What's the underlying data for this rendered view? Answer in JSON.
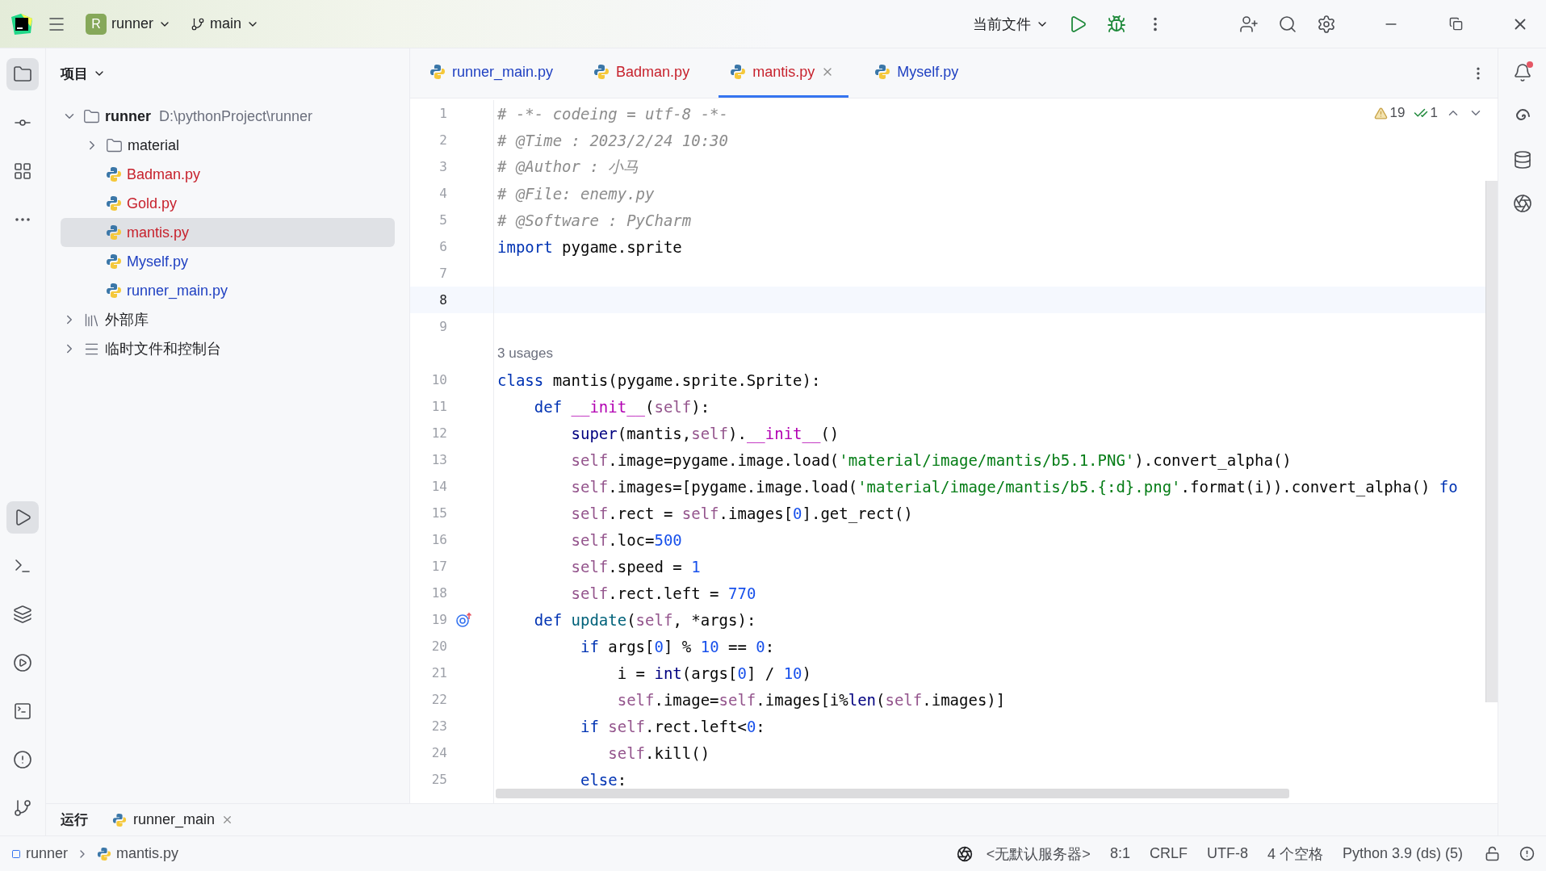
{
  "toolbar": {
    "project_badge": "R",
    "project": "runner",
    "branch": "main",
    "run_config": "当前文件"
  },
  "left_tools_top": [
    {
      "kind": "project",
      "selected": true
    },
    {
      "kind": "commit",
      "selected": false
    },
    {
      "kind": "structure",
      "selected": false
    },
    {
      "kind": "more",
      "selected": false
    }
  ],
  "left_tools_bottom": [
    {
      "kind": "run",
      "selected": true
    },
    {
      "kind": "console",
      "selected": false
    },
    {
      "kind": "layers",
      "selected": false
    },
    {
      "kind": "services",
      "selected": false
    },
    {
      "kind": "terminal",
      "selected": false
    },
    {
      "kind": "problems",
      "selected": false
    },
    {
      "kind": "git",
      "selected": false
    }
  ],
  "right_tools": [
    {
      "kind": "notifications",
      "unread": true
    },
    {
      "kind": "ai",
      "unread": false
    },
    {
      "kind": "database",
      "unread": false
    },
    {
      "kind": "assistant",
      "unread": false
    }
  ],
  "project_panel": {
    "title": "项目",
    "tree": [
      {
        "label": "runner",
        "path": "D:\\pythonProject\\runner",
        "kind": "folder",
        "expanded": true,
        "selected": false,
        "children": [
          {
            "label": "material",
            "kind": "folder",
            "expanded": false,
            "selected": false
          },
          {
            "label": "Badman.py",
            "kind": "python",
            "color": "#c7222d",
            "selected": false
          },
          {
            "label": "Gold.py",
            "kind": "python",
            "color": "#c7222d",
            "selected": false
          },
          {
            "label": "mantis.py",
            "kind": "python",
            "color": "#c7222d",
            "selected": true
          },
          {
            "label": "Myself.py",
            "kind": "python",
            "color": "#2041c2",
            "selected": false
          },
          {
            "label": "runner_main.py",
            "kind": "python",
            "color": "#2041c2",
            "selected": false
          }
        ]
      },
      {
        "label": "外部库",
        "kind": "library",
        "expanded": false,
        "selected": false
      },
      {
        "label": "临时文件和控制台",
        "kind": "scratch",
        "expanded": false,
        "selected": false
      }
    ]
  },
  "tabs": [
    {
      "label": "runner_main.py",
      "color": "#2041c2",
      "selected": false
    },
    {
      "label": "Badman.py",
      "color": "#c7222d",
      "selected": false
    },
    {
      "label": "mantis.py",
      "color": "#c7222d",
      "selected": true
    },
    {
      "label": "Myself.py",
      "color": "#2041c2",
      "selected": false
    }
  ],
  "inspections": {
    "warnings": "19",
    "ok": "1"
  },
  "lines": [
    {
      "no": "1",
      "tokens": [
        {
          "kind": "comment",
          "text": "# -*- codeing = utf-8 -*-"
        }
      ]
    },
    {
      "no": "2",
      "tokens": [
        {
          "kind": "comment",
          "text": "# @Time : 2023/2/24 10:30"
        }
      ]
    },
    {
      "no": "3",
      "tokens": [
        {
          "kind": "comment",
          "text": "# @Author : 小马"
        }
      ]
    },
    {
      "no": "4",
      "tokens": [
        {
          "kind": "comment",
          "text": "# @File: enemy.py"
        }
      ]
    },
    {
      "no": "5",
      "tokens": [
        {
          "kind": "comment",
          "text": "# @Software : PyCharm"
        }
      ]
    },
    {
      "no": "6",
      "tokens": [
        {
          "kind": "keyword",
          "text": "import"
        },
        {
          "kind": "plain",
          "text": " pygame.sprite"
        }
      ]
    },
    {
      "no": "7"
    },
    {
      "no": "8",
      "current": true
    },
    {
      "no": "9"
    },
    {
      "no": "10",
      "hint": "3 usages",
      "tokens": [
        {
          "kind": "keyword",
          "text": "class"
        },
        {
          "kind": "plain",
          "text": " mantis(pygame.sprite.Sprite):"
        }
      ]
    },
    {
      "no": "11",
      "tokens": [
        {
          "kind": "keyword",
          "text": "    def"
        },
        {
          "kind": "magic",
          "text": " __init__"
        },
        {
          "kind": "plain",
          "text": "("
        },
        {
          "kind": "self",
          "text": "self"
        },
        {
          "kind": "plain",
          "text": "):"
        }
      ]
    },
    {
      "no": "12",
      "tokens": [
        {
          "kind": "builtin",
          "text": "        super"
        },
        {
          "kind": "plain",
          "text": "(mantis,"
        },
        {
          "kind": "self",
          "text": "self"
        },
        {
          "kind": "plain",
          "text": ")."
        },
        {
          "kind": "magic",
          "text": "__init__"
        },
        {
          "kind": "plain",
          "text": "()"
        }
      ]
    },
    {
      "no": "13",
      "tokens": [
        {
          "kind": "self",
          "text": "        self"
        },
        {
          "kind": "plain",
          "text": ".image=pygame.image.load("
        },
        {
          "kind": "string",
          "text": "'material/image/mantis/b5.1.PNG'"
        },
        {
          "kind": "plain",
          "text": ").convert_alpha()"
        }
      ]
    },
    {
      "no": "14",
      "tokens": [
        {
          "kind": "self",
          "text": "        self"
        },
        {
          "kind": "plain",
          "text": ".images=[pygame.image.load("
        },
        {
          "kind": "string",
          "text": "'material/image/mantis/b5.{:d}.png'"
        },
        {
          "kind": "plain",
          "text": ".format(i)).convert_alpha()"
        },
        {
          "kind": "keyword",
          "text": " fo"
        }
      ]
    },
    {
      "no": "15",
      "tokens": [
        {
          "kind": "self",
          "text": "        self"
        },
        {
          "kind": "plain",
          "text": ".rect = "
        },
        {
          "kind": "self",
          "text": "self"
        },
        {
          "kind": "plain",
          "text": ".images["
        },
        {
          "kind": "number",
          "text": "0"
        },
        {
          "kind": "plain",
          "text": "].get_rect()"
        }
      ]
    },
    {
      "no": "16",
      "tokens": [
        {
          "kind": "self",
          "text": "        self"
        },
        {
          "kind": "plain",
          "text": ".loc="
        },
        {
          "kind": "number",
          "text": "500"
        }
      ]
    },
    {
      "no": "17",
      "tokens": [
        {
          "kind": "self",
          "text": "        self"
        },
        {
          "kind": "plain",
          "text": ".speed = "
        },
        {
          "kind": "number",
          "text": "1"
        }
      ]
    },
    {
      "no": "18",
      "tokens": [
        {
          "kind": "self",
          "text": "        self"
        },
        {
          "kind": "plain",
          "text": ".rect.left = "
        },
        {
          "kind": "number",
          "text": "770"
        }
      ]
    },
    {
      "no": "19",
      "gutter": {
        "kind": "override"
      },
      "tokens": [
        {
          "kind": "keyword",
          "text": "    def"
        },
        {
          "kind": "function",
          "text": " update"
        },
        {
          "kind": "plain",
          "text": "("
        },
        {
          "kind": "self",
          "text": "self"
        },
        {
          "kind": "plain",
          "text": ", *args):"
        }
      ]
    },
    {
      "no": "20",
      "tokens": [
        {
          "kind": "keyword",
          "text": "         if"
        },
        {
          "kind": "plain",
          "text": " args["
        },
        {
          "kind": "number",
          "text": "0"
        },
        {
          "kind": "plain",
          "text": "] % "
        },
        {
          "kind": "number",
          "text": "10"
        },
        {
          "kind": "plain",
          "text": " == "
        },
        {
          "kind": "number",
          "text": "0"
        },
        {
          "kind": "plain",
          "text": ":"
        }
      ]
    },
    {
      "no": "21",
      "tokens": [
        {
          "kind": "plain",
          "text": "             i = "
        },
        {
          "kind": "builtin",
          "text": "int"
        },
        {
          "kind": "plain",
          "text": "(args["
        },
        {
          "kind": "number",
          "text": "0"
        },
        {
          "kind": "plain",
          "text": "] / "
        },
        {
          "kind": "number",
          "text": "10"
        },
        {
          "kind": "plain",
          "text": ")"
        }
      ]
    },
    {
      "no": "22",
      "tokens": [
        {
          "kind": "self",
          "text": "             self"
        },
        {
          "kind": "plain",
          "text": ".image="
        },
        {
          "kind": "self",
          "text": "self"
        },
        {
          "kind": "plain",
          "text": ".images[i%"
        },
        {
          "kind": "builtin",
          "text": "len"
        },
        {
          "kind": "plain",
          "text": "("
        },
        {
          "kind": "self",
          "text": "self"
        },
        {
          "kind": "plain",
          "text": ".images)]"
        }
      ]
    },
    {
      "no": "23",
      "tokens": [
        {
          "kind": "keyword",
          "text": "         if"
        },
        {
          "kind": "self",
          "text": " self"
        },
        {
          "kind": "plain",
          "text": ".rect.left<"
        },
        {
          "kind": "number",
          "text": "0"
        },
        {
          "kind": "plain",
          "text": ":"
        }
      ]
    },
    {
      "no": "24",
      "tokens": [
        {
          "kind": "self",
          "text": "            self"
        },
        {
          "kind": "plain",
          "text": ".kill()"
        }
      ]
    },
    {
      "no": "25",
      "tokens": [
        {
          "kind": "keyword",
          "text": "         else"
        },
        {
          "kind": "plain",
          "text": ":"
        }
      ]
    }
  ],
  "bottom_panel": {
    "title": "运行",
    "tabs": [
      {
        "label": "runner_main",
        "selected": true
      }
    ]
  },
  "status_bar": {
    "breadcrumb": [
      "runner",
      "mantis.py"
    ],
    "items": [
      "<无默认服务器>",
      "8:1",
      "CRLF",
      "UTF-8",
      "4 个空格",
      "Python 3.9 (ds) (5)"
    ]
  }
}
